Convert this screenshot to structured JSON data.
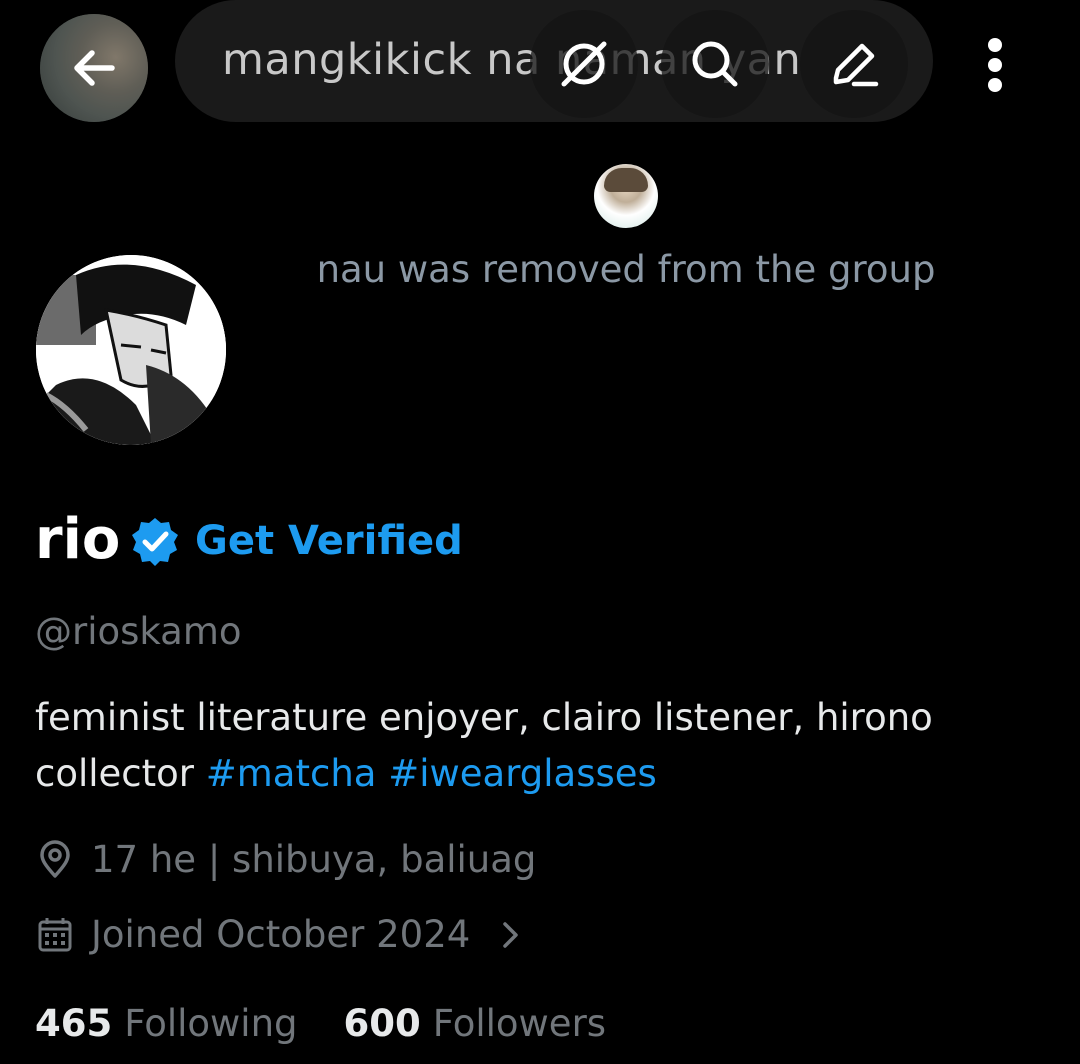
{
  "header": {
    "title": "mangkikick na naman yan",
    "back_icon": "arrow-left-icon",
    "icons": [
      "notifications-off-icon",
      "search-icon",
      "edit-icon",
      "more-vertical-icon"
    ]
  },
  "system_message": {
    "text": "nau was removed from the group"
  },
  "profile": {
    "name": "rio",
    "get_verified_label": "Get Verified",
    "handle": "@rioskamo",
    "bio_text": "feminist literature enjoyer, clairo listener, hirono collector ",
    "bio_tags": [
      "#matcha",
      "#iwearglasses"
    ],
    "location": "17 he | shibuya, baliuag",
    "joined": "Joined October 2024",
    "following_count": "465",
    "following_label": "Following",
    "followers_count": "600",
    "followers_label": "Followers"
  },
  "colors": {
    "background": "#000000",
    "accent": "#1d9bf0",
    "secondary_text": "#71767b",
    "primary_text": "#e7e9ea"
  }
}
